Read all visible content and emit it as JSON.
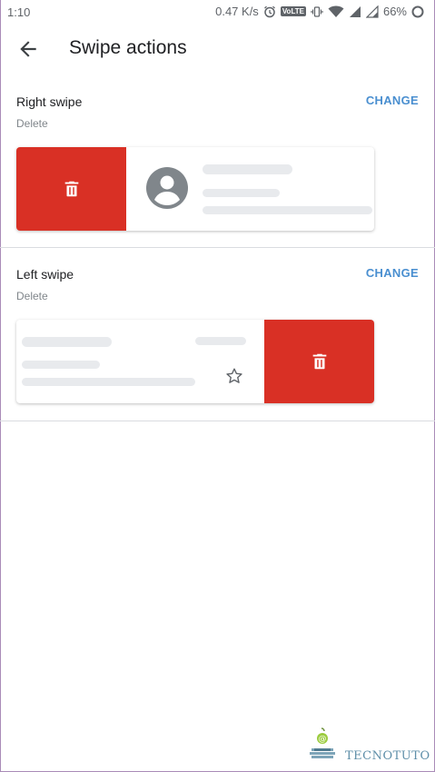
{
  "status_bar": {
    "time": "1:10",
    "speed": "0.47 K/s",
    "network_badge": "VoLTE",
    "battery": "66%",
    "icons": [
      "alarm-icon",
      "vibrate-icon",
      "wifi-icon",
      "signal-icon",
      "battery-icon"
    ]
  },
  "app_bar": {
    "back_icon": "arrow-back-icon",
    "title": "Swipe actions"
  },
  "right_swipe": {
    "label": "Right swipe",
    "value": "Delete",
    "change_label": "CHANGE",
    "action_icon": "trash-icon",
    "preview_icon": "avatar-icon"
  },
  "left_swipe": {
    "label": "Left swipe",
    "value": "Delete",
    "change_label": "CHANGE",
    "action_icon": "trash-icon",
    "preview_icon": "star-outline-icon"
  },
  "watermark": {
    "text": "TECNOTUTO"
  },
  "colors": {
    "action_red": "#d93025",
    "link_blue": "#4a8fd0",
    "placeholder_gray": "#e8eaed"
  }
}
